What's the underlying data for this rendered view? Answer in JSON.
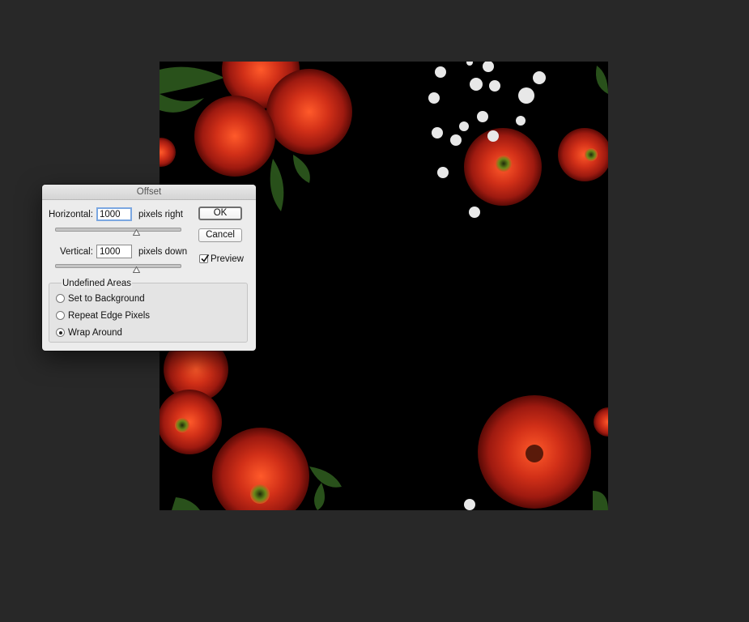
{
  "dialog": {
    "title": "Offset",
    "horizontal": {
      "label": "Horizontal:",
      "value": "1000",
      "unit": "pixels right"
    },
    "vertical": {
      "label": "Vertical:",
      "value": "1000",
      "unit": "pixels down"
    },
    "ok_label": "OK",
    "cancel_label": "Cancel",
    "preview": {
      "label": "Preview",
      "checked": true
    },
    "undefined_areas": {
      "title": "Undefined Areas",
      "options": [
        {
          "label": "Set to Background",
          "selected": false
        },
        {
          "label": "Repeat Edge Pixels",
          "selected": false
        },
        {
          "label": "Wrap Around",
          "selected": true
        }
      ]
    }
  },
  "colors": {
    "workspace": "#282828",
    "canvas": "#000000",
    "flower_red": "#c0281a",
    "flower_center": "#6a8a1a",
    "leaf_green": "#2e5a1e",
    "babys_breath": "#e8e8e8"
  }
}
